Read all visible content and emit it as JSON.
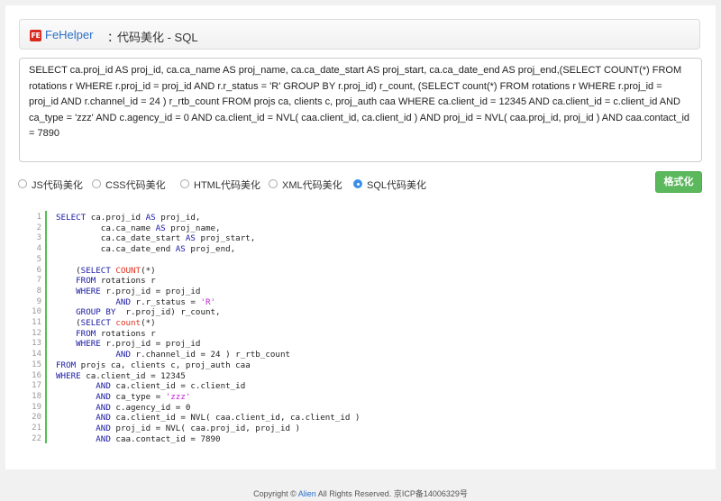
{
  "header": {
    "logo_text": "FE",
    "brand": "FeHelper",
    "separator": "：",
    "title": "代码美化 - SQL"
  },
  "input": {
    "value": "SELECT ca.proj_id AS proj_id, ca.ca_name AS proj_name, ca.ca_date_start AS proj_start, ca.ca_date_end AS proj_end,(SELECT COUNT(*) FROM rotations r WHERE r.proj_id = proj_id AND r.r_status = 'R' GROUP BY r.proj_id) r_count, (SELECT count(*) FROM rotations r WHERE r.proj_id = proj_id AND r.channel_id = 24 ) r_rtb_count FROM projs ca, clients c, proj_auth caa WHERE ca.client_id = 12345 AND ca.client_id = c.client_id AND ca_type = 'zzz' AND c.agency_id = 0 AND ca.client_id = NVL( caa.client_id, ca.client_id ) AND proj_id = NVL( caa.proj_id, proj_id ) AND caa.contact_id = 7890"
  },
  "options": [
    {
      "label": "JS代码美化",
      "checked": false
    },
    {
      "label": "CSS代码美化",
      "checked": false
    },
    {
      "label": "HTML代码美化",
      "checked": false
    },
    {
      "label": "XML代码美化",
      "checked": false
    },
    {
      "label": "SQL代码美化",
      "checked": true
    }
  ],
  "format_button": "格式化",
  "code_lines": [
    [
      [
        "kw",
        "SELECT"
      ],
      [
        "t",
        " ca.proj_id "
      ],
      [
        "kw",
        "AS"
      ],
      [
        "t",
        " proj_id,"
      ]
    ],
    [
      [
        "t",
        "         ca.ca_name "
      ],
      [
        "kw",
        "AS"
      ],
      [
        "t",
        " proj_name,"
      ]
    ],
    [
      [
        "t",
        "         ca.ca_date_start "
      ],
      [
        "kw",
        "AS"
      ],
      [
        "t",
        " proj_start,"
      ]
    ],
    [
      [
        "t",
        "         ca.ca_date_end "
      ],
      [
        "kw",
        "AS"
      ],
      [
        "t",
        " proj_end,"
      ]
    ],
    [
      [
        "t",
        ""
      ]
    ],
    [
      [
        "t",
        "    ("
      ],
      [
        "kw",
        "SELECT"
      ],
      [
        "t",
        " "
      ],
      [
        "fn",
        "COUNT"
      ],
      [
        "t",
        "(*)"
      ]
    ],
    [
      [
        "t",
        "    "
      ],
      [
        "kw",
        "FROM"
      ],
      [
        "t",
        " rotations r"
      ]
    ],
    [
      [
        "t",
        "    "
      ],
      [
        "kw",
        "WHERE"
      ],
      [
        "t",
        " r.proj_id = proj_id"
      ]
    ],
    [
      [
        "t",
        "            "
      ],
      [
        "kw",
        "AND"
      ],
      [
        "t",
        " r.r_status = "
      ],
      [
        "st",
        "'R'"
      ]
    ],
    [
      [
        "t",
        "    "
      ],
      [
        "kw",
        "GROUP BY"
      ],
      [
        "t",
        "  r.proj_id) r_count,"
      ]
    ],
    [
      [
        "t",
        "    ("
      ],
      [
        "kw",
        "SELECT"
      ],
      [
        "t",
        " "
      ],
      [
        "fn",
        "count"
      ],
      [
        "t",
        "(*)"
      ]
    ],
    [
      [
        "t",
        "    "
      ],
      [
        "kw",
        "FROM"
      ],
      [
        "t",
        " rotations r"
      ]
    ],
    [
      [
        "t",
        "    "
      ],
      [
        "kw",
        "WHERE"
      ],
      [
        "t",
        " r.proj_id = proj_id"
      ]
    ],
    [
      [
        "t",
        "            "
      ],
      [
        "kw",
        "AND"
      ],
      [
        "t",
        " r.channel_id = 24 ) r_rtb_count"
      ]
    ],
    [
      [
        "kw",
        "FROM"
      ],
      [
        "t",
        " projs ca, clients c, proj_auth caa"
      ]
    ],
    [
      [
        "kw",
        "WHERE"
      ],
      [
        "t",
        " ca.client_id = 12345"
      ]
    ],
    [
      [
        "t",
        "        "
      ],
      [
        "kw",
        "AND"
      ],
      [
        "t",
        " ca.client_id = c.client_id"
      ]
    ],
    [
      [
        "t",
        "        "
      ],
      [
        "kw",
        "AND"
      ],
      [
        "t",
        " ca_type = "
      ],
      [
        "st",
        "'zzz'"
      ]
    ],
    [
      [
        "t",
        "        "
      ],
      [
        "kw",
        "AND"
      ],
      [
        "t",
        " c.agency_id = 0"
      ]
    ],
    [
      [
        "t",
        "        "
      ],
      [
        "kw",
        "AND"
      ],
      [
        "t",
        " ca.client_id = NVL( caa.client_id, ca.client_id )"
      ]
    ],
    [
      [
        "t",
        "        "
      ],
      [
        "kw",
        "AND"
      ],
      [
        "t",
        " proj_id = NVL( caa.proj_id, proj_id )"
      ]
    ],
    [
      [
        "t",
        "        "
      ],
      [
        "kw",
        "AND"
      ],
      [
        "t",
        " caa.contact_id = 7890"
      ]
    ]
  ],
  "footer": {
    "prefix": "Copyright © ",
    "author": "Alien",
    "suffix": "  All Rights Reserved.  京ICP备14006329号"
  }
}
